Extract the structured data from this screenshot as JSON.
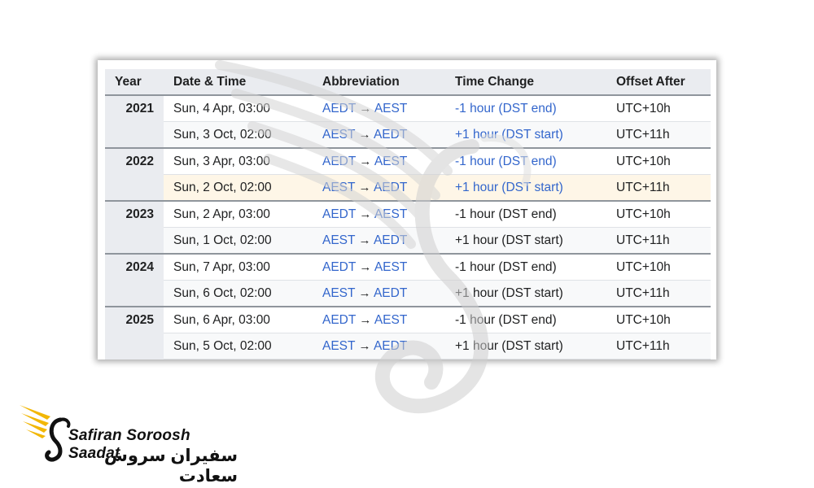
{
  "table": {
    "headers": [
      "Year",
      "Date & Time",
      "Abbreviation",
      "Time Change",
      "Offset After"
    ],
    "groups": [
      {
        "year": "2021",
        "rows": [
          {
            "date": "Sun, 4 Apr, 03:00",
            "abbr_from": "AEDT",
            "abbr_to": "AEST",
            "change": "-1 hour (DST end)",
            "offset": "UTC+10h"
          },
          {
            "date": "Sun, 3 Oct, 02:00",
            "abbr_from": "AEST",
            "abbr_to": "AEDT",
            "change": "+1 hour (DST start)",
            "offset": "UTC+11h"
          }
        ]
      },
      {
        "year": "2022",
        "rows": [
          {
            "date": "Sun, 3 Apr, 03:00",
            "abbr_from": "AEDT",
            "abbr_to": "AEST",
            "change": "-1 hour (DST end)",
            "offset": "UTC+10h"
          },
          {
            "date": "Sun, 2 Oct, 02:00",
            "abbr_from": "AEST",
            "abbr_to": "AEDT",
            "change": "+1 hour (DST start)",
            "offset": "UTC+11h"
          }
        ]
      },
      {
        "year": "2023",
        "rows": [
          {
            "date": "Sun, 2 Apr, 03:00",
            "abbr_from": "AEDT",
            "abbr_to": "AEST",
            "change": "-1 hour (DST end)",
            "offset": "UTC+10h"
          },
          {
            "date": "Sun, 1 Oct, 02:00",
            "abbr_from": "AEST",
            "abbr_to": "AEDT",
            "change": "+1 hour (DST start)",
            "offset": "UTC+11h"
          }
        ]
      },
      {
        "year": "2024",
        "rows": [
          {
            "date": "Sun, 7 Apr, 03:00",
            "abbr_from": "AEDT",
            "abbr_to": "AEST",
            "change": "-1 hour (DST end)",
            "offset": "UTC+10h"
          },
          {
            "date": "Sun, 6 Oct, 02:00",
            "abbr_from": "AEST",
            "abbr_to": "AEDT",
            "change": "+1 hour (DST start)",
            "offset": "UTC+11h"
          }
        ]
      },
      {
        "year": "2025",
        "rows": [
          {
            "date": "Sun, 6 Apr, 03:00",
            "abbr_from": "AEDT",
            "abbr_to": "AEST",
            "change": "-1 hour (DST end)",
            "offset": "UTC+10h"
          },
          {
            "date": "Sun, 5 Oct, 02:00",
            "abbr_from": "AEST",
            "abbr_to": "AEDT",
            "change": "+1 hour (DST start)",
            "offset": "UTC+11h"
          }
        ]
      }
    ],
    "arrow_glyph": "→"
  },
  "brand": {
    "name_en": "Safiran Soroosh Saadat",
    "name_fa": "سفیران سروش سعادت",
    "logo_icon": "winged-swan-icon",
    "colors": {
      "gold": "#f2b705",
      "dark": "#111111"
    }
  },
  "watermark": {
    "icon": "winged-swan-watermark-icon"
  },
  "colors": {
    "link_blue": "#3366cc",
    "header_bg": "#eaecf0",
    "highlight_row": "#fef6e7",
    "alt_row": "#f8f9fa"
  }
}
